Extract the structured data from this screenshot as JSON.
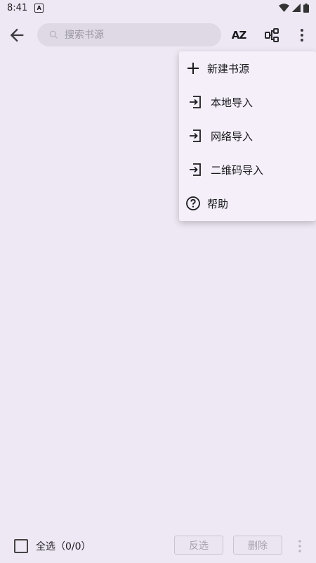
{
  "status_bar": {
    "time": "8:41",
    "badge_letter": "A"
  },
  "toolbar": {
    "search_placeholder": "搜索书源",
    "sort_label": "AZ"
  },
  "menu": {
    "items": [
      {
        "label": "新建书源",
        "icon": "plus-icon"
      },
      {
        "label": "本地导入",
        "icon": "import-icon"
      },
      {
        "label": "网络导入",
        "icon": "import-icon"
      },
      {
        "label": "二维码导入",
        "icon": "import-icon"
      },
      {
        "label": "帮助",
        "icon": "help-icon"
      }
    ]
  },
  "bottom_bar": {
    "select_all_label": "全选（0/0）",
    "invert_label": "反选",
    "delete_label": "删除"
  },
  "colors": {
    "background": "#eee8f4",
    "search_bg": "#dfd9e6",
    "menu_bg": "#f4eff9"
  }
}
